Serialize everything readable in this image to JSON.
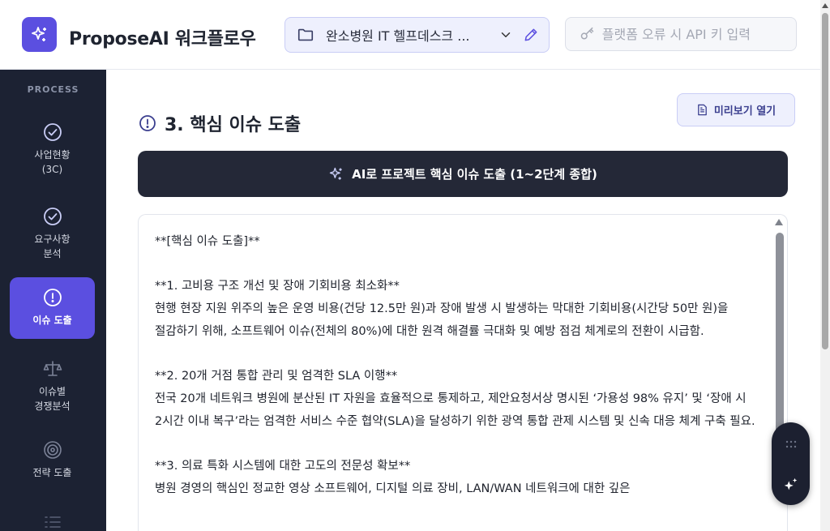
{
  "header": {
    "app_title": "ProposeAI 워크플로우",
    "project_name": "완소병원 IT 헬프데스크 ...",
    "api_placeholder": "플랫폼 오류 시 API 키 입력",
    "api_value": ""
  },
  "sidebar": {
    "heading": "PROCESS",
    "items": [
      {
        "label_line1": "사업현황",
        "label_line2": "(3C)",
        "icon": "check-circle-icon",
        "state": "done"
      },
      {
        "label_line1": "요구사항",
        "label_line2": "분석",
        "icon": "check-circle-icon",
        "state": "done"
      },
      {
        "label_line1": "이슈 도출",
        "label_line2": "",
        "icon": "alert-circle-icon",
        "state": "active"
      },
      {
        "label_line1": "이슈별",
        "label_line2": "경쟁분석",
        "icon": "scale-icon",
        "state": "pending"
      },
      {
        "label_line1": "전략 도출",
        "label_line2": "",
        "icon": "target-icon",
        "state": "pending"
      }
    ]
  },
  "main": {
    "title": "3. 핵심 이슈 도출",
    "preview_label": "미리보기 열기",
    "ai_button_label": "AI로 프로젝트 핵심 이슈 도출 (1~2단계 종합)",
    "editor_content": "**[핵심 이슈 도출]**\n\n**1. 고비용 구조 개선 및 장애 기회비용 최소화**\n현행 현장 지원 위주의 높은 운영 비용(건당 12.5만 원)과 장애 발생 시 발생하는 막대한 기회비용(시간당 50만 원)을 절감하기 위해, 소프트웨어 이슈(전체의 80%)에 대한 원격 해결률 극대화 및 예방 점검 체계로의 전환이 시급함.\n\n**2. 20개 거점 통합 관리 및 엄격한 SLA 이행**\n전국 20개 네트워크 병원에 분산된 IT 자원을 효율적으로 통제하고, 제안요청서상 명시된 ‘가용성 98% 유지’ 및 ‘장애 시 2시간 이내 복구’라는 엄격한 서비스 수준 협약(SLA)을 달성하기 위한 광역 통합 관제 시스템 및 신속 대응 체계 구축 필요.\n\n**3. 의료 특화 시스템에 대한 고도의 전문성 확보**\n병원 경영의 핵심인 정교한 영상 소프트웨어, 디지털 의료 장비, LAN/WAN 네트워크에 대한 깊은"
  },
  "colors": {
    "accent": "#5b4fe0",
    "sidebar_bg": "#1c2233",
    "dark_button": "#242837"
  }
}
